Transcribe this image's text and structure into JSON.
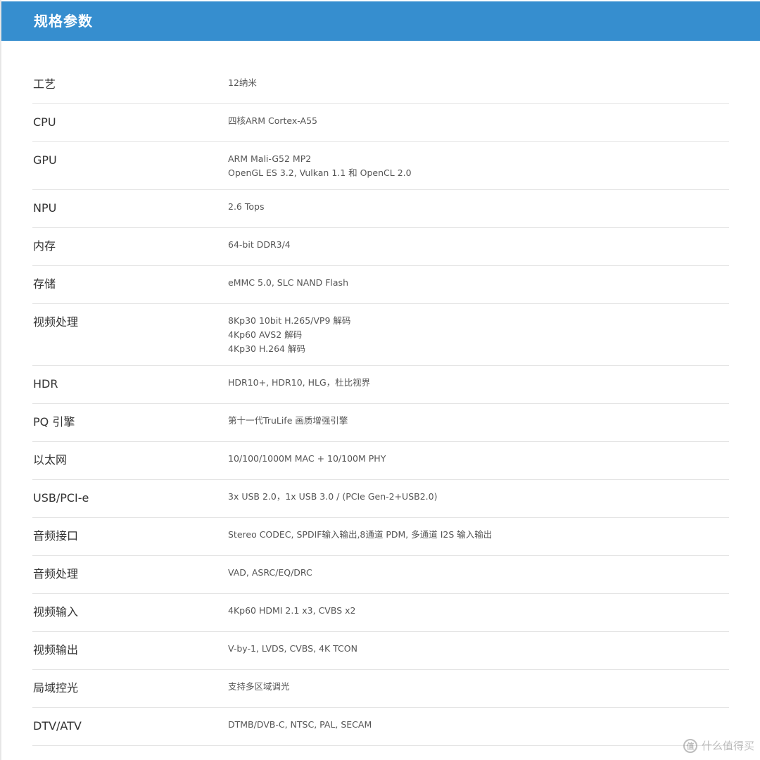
{
  "header": {
    "title": "规格参数"
  },
  "specs": [
    {
      "label": "工艺",
      "lines": [
        "12纳米"
      ]
    },
    {
      "label": "CPU",
      "lines": [
        "四核ARM Cortex-A55"
      ]
    },
    {
      "label": "GPU",
      "lines": [
        "ARM Mali-G52 MP2",
        "OpenGL ES 3.2, Vulkan 1.1 和 OpenCL 2.0"
      ]
    },
    {
      "label": "NPU",
      "lines": [
        "2.6 Tops"
      ]
    },
    {
      "label": "内存",
      "lines": [
        "64-bit DDR3/4"
      ]
    },
    {
      "label": "存储",
      "lines": [
        "eMMC 5.0, SLC NAND Flash"
      ]
    },
    {
      "label": "视频处理",
      "lines": [
        "8Kp30 10bit H.265/VP9 解码",
        "4Kp60 AVS2 解码",
        "4Kp30 H.264 解码"
      ]
    },
    {
      "label": "HDR",
      "lines": [
        "HDR10+, HDR10, HLG，杜比视界"
      ]
    },
    {
      "label": "PQ 引擎",
      "lines": [
        "第十一代TruLife 画质增强引擎"
      ]
    },
    {
      "label": "以太网",
      "lines": [
        "10/100/1000M MAC + 10/100M PHY"
      ]
    },
    {
      "label": "USB/PCI-e",
      "lines": [
        "3x USB 2.0，1x USB 3.0 / (PCIe Gen-2+USB2.0)"
      ]
    },
    {
      "label": "音频接口",
      "lines": [
        "Stereo CODEC, SPDIF输入输出,8通道 PDM, 多通道 I2S 输入输出"
      ]
    },
    {
      "label": "音频处理",
      "lines": [
        "VAD, ASRC/EQ/DRC"
      ]
    },
    {
      "label": "视频输入",
      "lines": [
        "4Kp60 HDMI 2.1 x3, CVBS x2"
      ]
    },
    {
      "label": "视频输出",
      "lines": [
        "V-by-1, LVDS, CVBS, 4K TCON"
      ]
    },
    {
      "label": "局域控光",
      "lines": [
        "支持多区域调光"
      ]
    },
    {
      "label": "DTV/ATV",
      "lines": [
        "DTMB/DVB-C, NTSC, PAL, SECAM"
      ]
    }
  ],
  "watermark": {
    "icon": "值",
    "text": "什么值得买"
  }
}
